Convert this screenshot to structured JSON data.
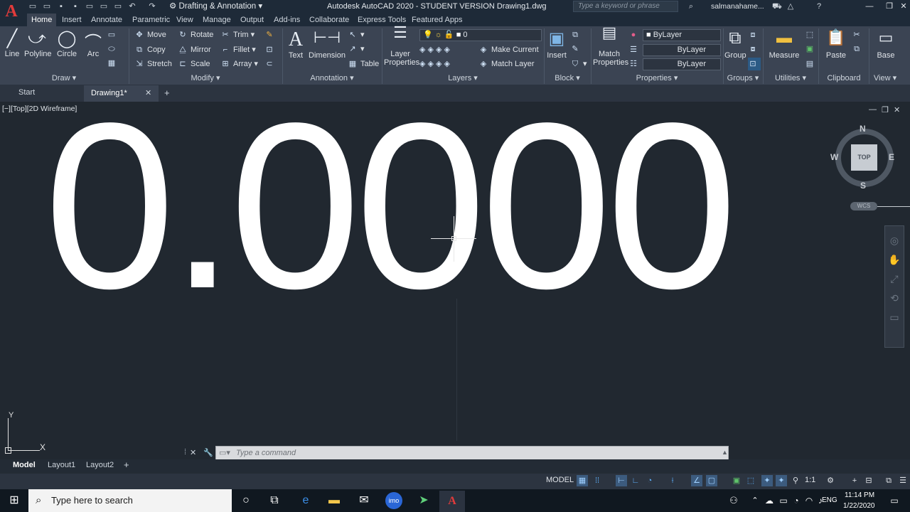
{
  "titlebar": {
    "workspace": "Drafting & Annotation",
    "title": "Autodesk AutoCAD 2020 - STUDENT VERSION    Drawing1.dwg",
    "search_placeholder": "Type a keyword or phrase",
    "user": "salmanahame..."
  },
  "menu_tabs": [
    "Home",
    "Insert",
    "Annotate",
    "Parametric",
    "View",
    "Manage",
    "Output",
    "Add-ins",
    "Collaborate",
    "Express Tools",
    "Featured Apps"
  ],
  "ribbon": {
    "draw": {
      "line": "Line",
      "polyline": "Polyline",
      "circle": "Circle",
      "arc": "Arc",
      "footer": "Draw"
    },
    "modify": {
      "move": "Move",
      "rotate": "Rotate",
      "trim": "Trim",
      "copy": "Copy",
      "mirror": "Mirror",
      "fillet": "Fillet",
      "stretch": "Stretch",
      "scale": "Scale",
      "array": "Array",
      "footer": "Modify"
    },
    "annotation": {
      "text": "Text",
      "dimension": "Dimension",
      "table": "Table",
      "footer": "Annotation"
    },
    "layers": {
      "layer_properties": "Layer Properties",
      "layer_value": "0",
      "make_current": "Make Current",
      "match_layer": "Match Layer",
      "footer": "Layers"
    },
    "block": {
      "insert": "Insert",
      "footer": "Block"
    },
    "properties": {
      "match_properties": "Match Properties",
      "color": "ByLayer",
      "linetype": "ByLayer",
      "lineweight": "ByLayer",
      "footer": "Properties"
    },
    "groups": {
      "group": "Group",
      "footer": "Groups"
    },
    "utilities": {
      "measure": "Measure",
      "footer": "Utilities"
    },
    "clipboard": {
      "paste": "Paste",
      "footer": "Clipboard"
    },
    "view": {
      "base": "Base",
      "footer": "View"
    }
  },
  "file_tabs": {
    "start": "Start",
    "drawing": "Drawing1*"
  },
  "viewport": {
    "label": "[−][Top][2D Wireframe]",
    "big_text": "0.0000"
  },
  "viewcube": {
    "north": "N",
    "south": "S",
    "east": "E",
    "west": "W",
    "top": "TOP",
    "wcs": "WCS"
  },
  "ucs": {
    "x": "X",
    "y": "Y"
  },
  "command": {
    "placeholder": "Type a command"
  },
  "layout_tabs": [
    "Model",
    "Layout1",
    "Layout2"
  ],
  "status": {
    "model": "MODEL",
    "scale": "1:1"
  },
  "taskbar": {
    "search": "Type here to search",
    "time": "11:14 PM",
    "date": "1/22/2020",
    "lang": "ENG"
  }
}
